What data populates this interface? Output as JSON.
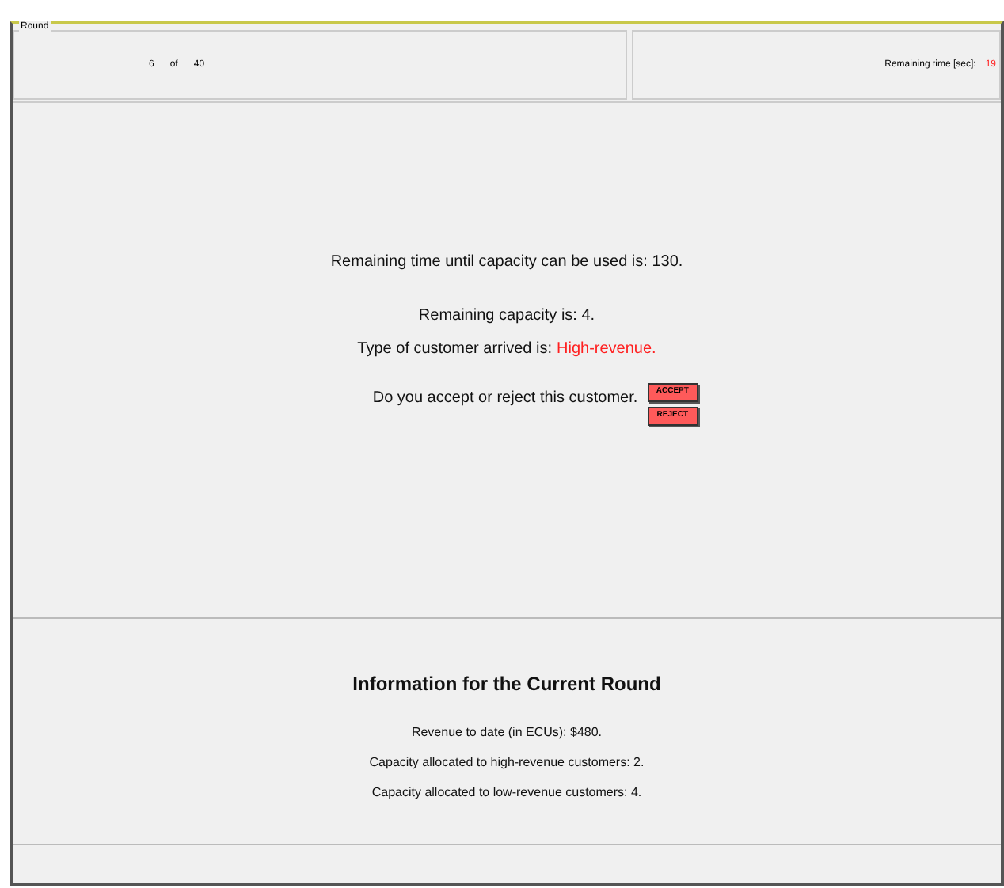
{
  "round": {
    "legend": "Round",
    "current": "6",
    "of": "of",
    "total": "40"
  },
  "timer": {
    "label": "Remaining time [sec]:",
    "value": "19"
  },
  "main": {
    "time_line": "Remaining time until capacity can be used is: 130.",
    "capacity_line": "Remaining capacity is: 4.",
    "customer_label": "Type of customer arrived is:",
    "customer_type": "High-revenue.",
    "question": "Do you accept or reject this customer.",
    "buttons": [
      "ACCEPT",
      "REJECT"
    ]
  },
  "info": {
    "title": "Information for the Current Round",
    "lines": [
      "Revenue to date (in ECUs): $480.",
      "Capacity allocated to high-revenue customers: 2.",
      "Capacity allocated to low-revenue customers: 4."
    ]
  }
}
